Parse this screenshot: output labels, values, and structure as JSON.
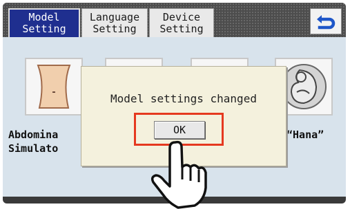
{
  "tabs": [
    {
      "label_line1": "Model",
      "label_line2": "Setting",
      "active": true
    },
    {
      "label_line1": "Language",
      "label_line2": "Setting",
      "active": false
    },
    {
      "label_line1": "Device",
      "label_line2": "Setting",
      "active": false
    }
  ],
  "back_button": {
    "icon": "return-arrow-icon",
    "color": "#1e56c8"
  },
  "models": [
    {
      "name": "Abdomina\nSimulato",
      "icon": "abdomen-icon"
    },
    {
      "name": "",
      "icon": "model-icon"
    },
    {
      "name": "",
      "icon": "model-icon"
    },
    {
      "name": "“Hana”",
      "icon": "fetus-icon"
    }
  ],
  "dialog": {
    "message": "Model settings changed",
    "ok_label": "OK"
  },
  "colors": {
    "active_tab": "#1f2f8f",
    "highlight": "#e5391f",
    "content_bg": "#d8e3ec",
    "dialog_bg": "#f4f1dd"
  },
  "pointer": {
    "icon": "pointing-hand-icon"
  }
}
